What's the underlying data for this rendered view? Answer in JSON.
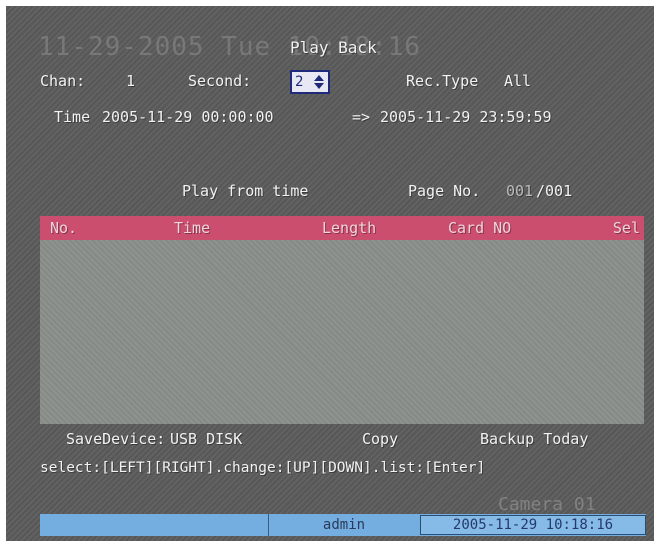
{
  "osd": {
    "date_overlay": "11-29-2005 Tue 10:18:16",
    "camera_watermark": "Camera 01"
  },
  "header": {
    "title": "Play Back"
  },
  "filters": {
    "chan_label": "Chan:",
    "chan_value": "1",
    "second_label": "Second:",
    "second_value": "2",
    "rec_type_label": "Rec.Type",
    "rec_type_value": "All"
  },
  "time_range": {
    "label": "Time",
    "start": "2005-11-29 00:00:00",
    "arrow": "=>",
    "end": "2005-11-29 23:59:59"
  },
  "controls": {
    "play_from_time": "Play from time",
    "page_label": "Page No.",
    "page_current": "001",
    "page_total": "/001"
  },
  "table": {
    "columns": [
      "No.",
      "Time",
      "Length",
      "Card NO",
      "Sel"
    ],
    "rows": []
  },
  "footer": {
    "save_device_label": "SaveDevice:",
    "save_device_value": "USB DISK",
    "copy": "Copy",
    "backup_today": "Backup Today",
    "help": "select:[LEFT][RIGHT].change:[UP][DOWN].list:[Enter]"
  },
  "status_bar": {
    "user": "admin",
    "datetime": "2005-11-29 10:18:16"
  },
  "colors": {
    "screen_bg": "#5c5c5c",
    "table_header_bg": "#cc4e6f",
    "table_body_bg": "#8a908c",
    "status_bar_bg": "#74aee0",
    "spin_border": "#1f2a7a"
  }
}
